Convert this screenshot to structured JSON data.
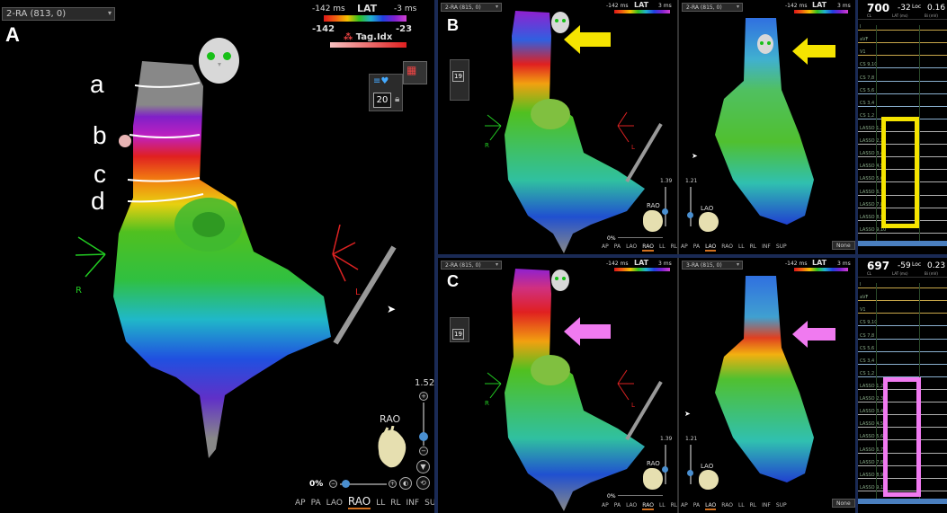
{
  "panel_a": {
    "letter": "A",
    "dropdown": "2-RA (813, 0)",
    "lat_title": "LAT",
    "lat_min": "-142 ms",
    "lat_max": "-3 ms",
    "tag_min": "-142",
    "tag_max": "-23",
    "tag_label": "Tag.Idx",
    "tool_value": "20",
    "segments": [
      "a",
      "b",
      "c",
      "d"
    ],
    "axis_left": "R",
    "axis_right": "L",
    "zoom_value": "1.52",
    "view_label": "RAO",
    "opacity_value": "0%",
    "nav_views": [
      "AP",
      "PA",
      "LAO",
      "RAO",
      "LL",
      "RL",
      "INF",
      "SUP"
    ],
    "selected_view": "RAO"
  },
  "panel_b": {
    "letter": "B",
    "left_dropdown": "2-RA (815, 0)",
    "right_dropdown": "2-RA (815, 0)",
    "lat_title": "LAT",
    "lat_min": "-142 ms",
    "lat_max": "3 ms",
    "tool_value": "19",
    "axis_left": "R",
    "axis_right": "L",
    "zoom_left": "1.39",
    "zoom_right": "1.21",
    "view_left": "RAO",
    "view_right": "LAO",
    "opacity_value": "0%",
    "nav_views": [
      "AP",
      "PA",
      "LAO",
      "RAO",
      "LL",
      "RL",
      "INF",
      "SUP"
    ],
    "none_label": "None",
    "cl_value": "700",
    "lat_value": "-32",
    "loc_label": "Loc",
    "loc_value": "0.16",
    "sub_labels": [
      "CL",
      "LAT (ms)",
      "Bi (mV)"
    ],
    "arrow_color": "#f5e400"
  },
  "panel_c": {
    "letter": "C",
    "left_dropdown": "2-RA (815, 0)",
    "right_dropdown": "3-RA (815, 0)",
    "lat_title": "LAT",
    "lat_min": "-142 ms",
    "lat_max": "3 ms",
    "tool_value": "19",
    "axis_left": "R",
    "axis_right": "L",
    "zoom_left": "1.39",
    "zoom_right": "1.21",
    "view_left": "RAO",
    "view_right": "LAO",
    "opacity_value": "0%",
    "nav_views": [
      "AP",
      "PA",
      "LAO",
      "RAO",
      "LL",
      "RL",
      "INF",
      "SUP"
    ],
    "none_label": "None",
    "cl_value": "697",
    "lat_value": "-59",
    "loc_label": "Loc",
    "loc_value": "0.23",
    "sub_labels": [
      "CL",
      "LAT (ms)",
      "Bi (mV)"
    ],
    "arrow_color": "#f07af0"
  },
  "egm_channels_b": [
    "I",
    "aVF",
    "V1",
    "CS 9,10",
    "CS 7,8",
    "CS 5,6",
    "CS 3,4",
    "CS 1,2",
    "LASSO 1,2",
    "LASSO 2,3",
    "LASSO 3,4",
    "LASSO 4,5",
    "LASSO 5,6",
    "LASSO 6,7",
    "LASSO 7,8",
    "LASSO 8,9",
    "LASSO 9,10"
  ],
  "egm_channels_c": [
    "I",
    "aVF",
    "V1",
    "CS 9,10",
    "CS 7,8",
    "CS 5,6",
    "CS 3,4",
    "CS 1,2",
    "LASSO 1,2",
    "LASSO 2,3",
    "LASSO 3,4",
    "LASSO 4,5",
    "LASSO 5,6",
    "LASSO 6,7",
    "LASSO 7,8",
    "LASSO 8,9",
    "LASSO 9,10"
  ],
  "colors": {
    "bg": "#000000",
    "separator": "#1a2a55",
    "highlight_yellow": "#f5e400",
    "highlight_magenta": "#f07af0",
    "axis_green": "#22cc22",
    "axis_red": "#dd2222"
  }
}
